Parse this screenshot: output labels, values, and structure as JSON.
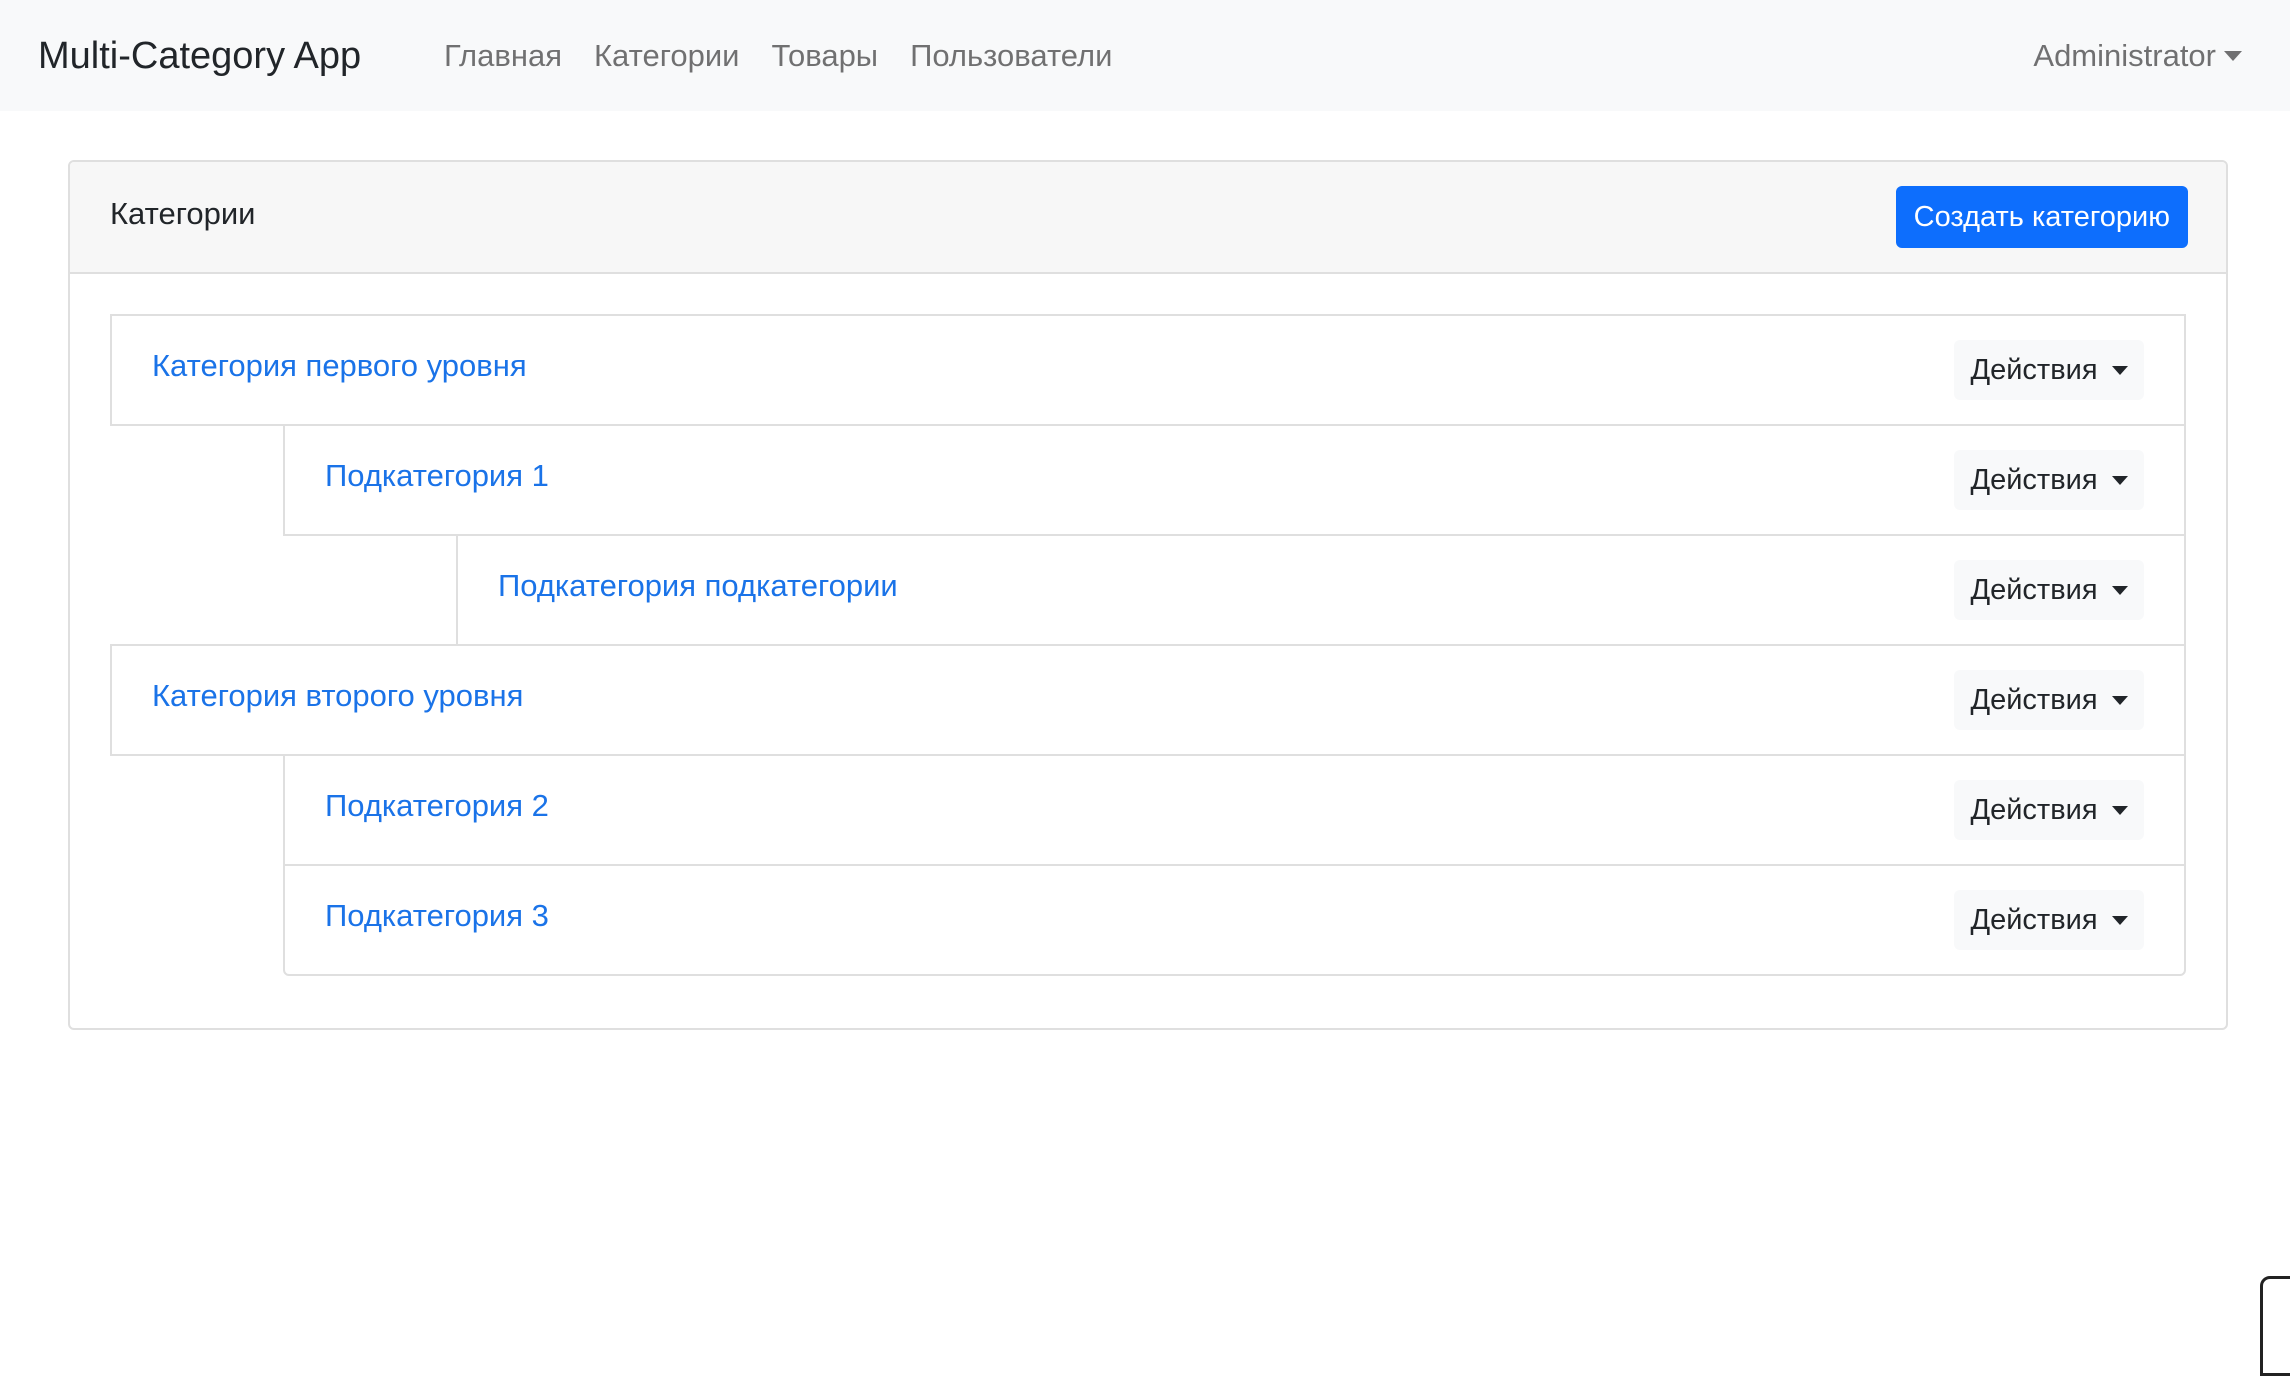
{
  "navbar": {
    "brand": "Multi-Category App",
    "links": [
      "Главная",
      "Категории",
      "Товары",
      "Пользователи"
    ],
    "user": "Administrator"
  },
  "card": {
    "title": "Категории",
    "create_button": "Создать категорию"
  },
  "categories": [
    {
      "name": "Категория первого уровня",
      "level": 0,
      "action_label": "Действия"
    },
    {
      "name": "Подкатегория 1",
      "level": 1,
      "action_label": "Действия"
    },
    {
      "name": "Подкатегория подкатегории",
      "level": 2,
      "action_label": "Действия"
    },
    {
      "name": "Категория второго уровня",
      "level": 0,
      "action_label": "Действия"
    },
    {
      "name": "Подкатегория 2",
      "level": 1,
      "action_label": "Действия"
    },
    {
      "name": "Подкатегория 3",
      "level": 1,
      "action_label": "Действия"
    }
  ],
  "colors": {
    "link": "#1a73e8",
    "primary": "#0d6efd",
    "navbar_bg": "#f8f9fa"
  }
}
